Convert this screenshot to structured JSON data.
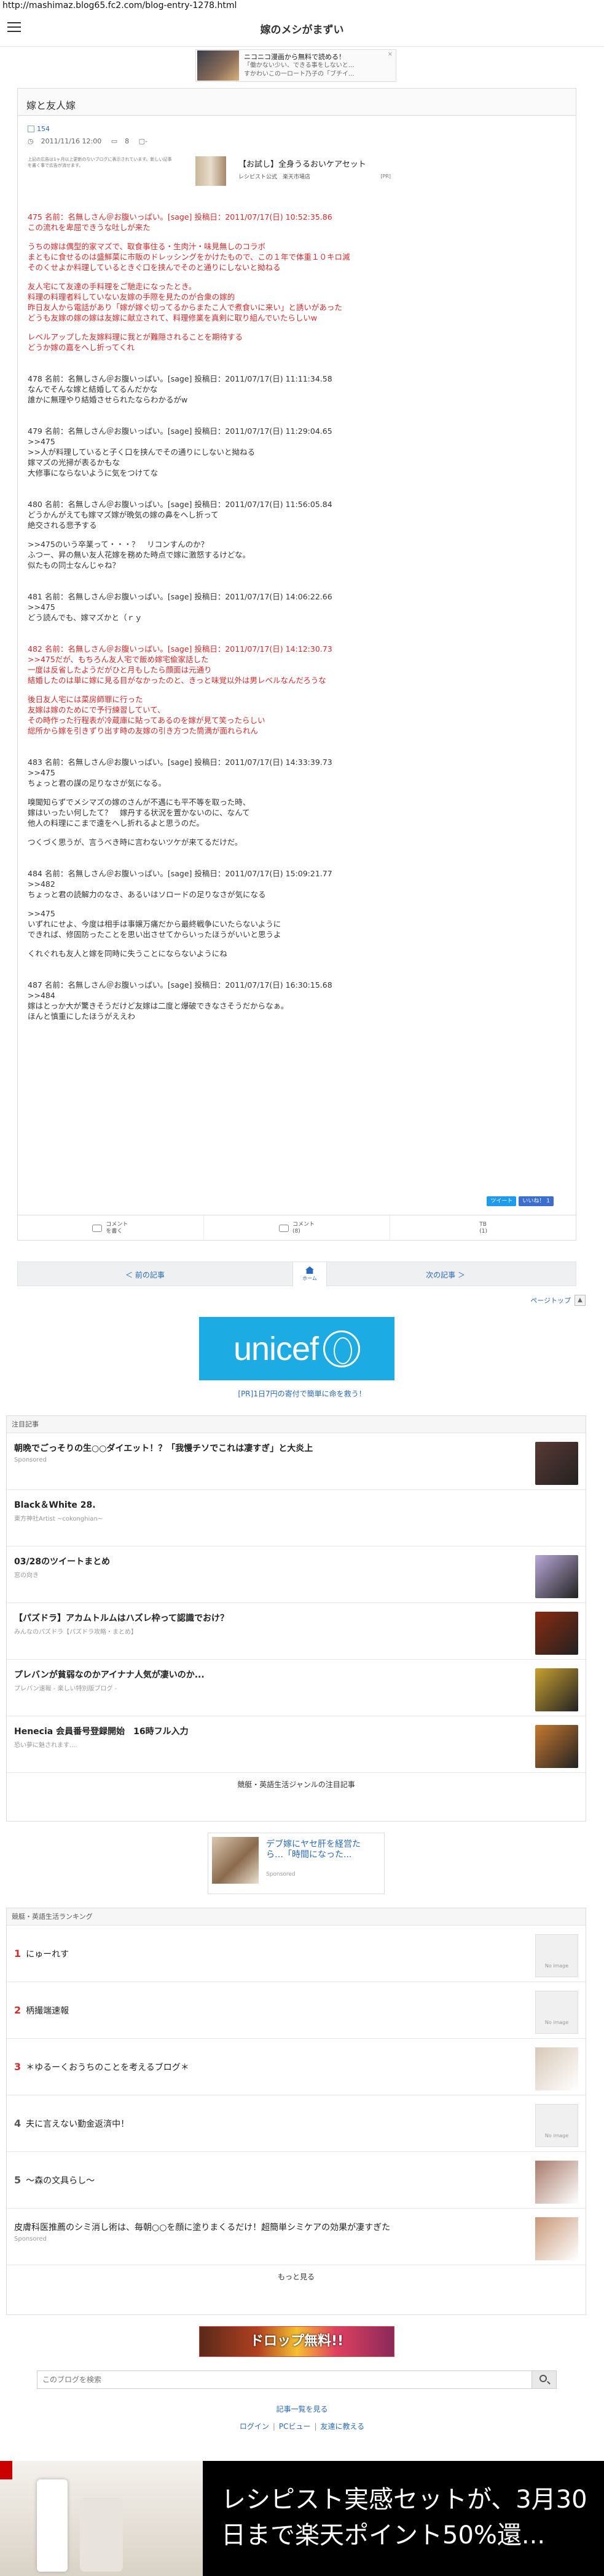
{
  "url": "http://mashimaz.blog65.fc2.com/blog-entry-1278.html",
  "site_title": "嫁のメシがまずい",
  "top_ad": {
    "line1": "ニコニコ漫画から無料で読める！",
    "line2": "「働かない少い、できる事をしないと…",
    "line3": "すかわいこの一ロート乃子の「ブチイ..."
  },
  "article": {
    "title": "嫁と友人嫁",
    "tag": "154",
    "date": "2011/11/16 12:00",
    "comments": "8",
    "note": "上記の広告は1ヶ月以上更新のないブログに表示されています。新しい記事を書く事で広告が消せます。",
    "ad_title": "【お試し】全身うるおいケアセット",
    "ad_sub": "レシピスト公式　楽天市場店",
    "ad_pr": "[PR]"
  },
  "posts": [
    {
      "h": "475 名前：名無しさん＠お腹いっぱい。[sage] 投稿日：2011/07/17(日) 10:52:35.86",
      "red": true,
      "lines": [
        "この流れを卑屈できうな吐しが来た",
        "",
        "うちの嫁は偶型的家マズで、取食事住る・生肉汁・味見無しのコラボ",
        "まともに食せるのは盛鮮菜に市販のドレッシングをかけたもので、この１年で体重１０キロ減",
        "そのくせよか料理しているときぐ口を挟んでそのと通りにしないと拗ねる",
        "",
        "友人宅にて友達の手料理をご馳走になったとき。",
        "料理の料理者料していない友嫁の手際を見たのが合衆の嫁的",
        "昨日友人から電話があり「嫁が嫁ぐ切ってるからまたこ人で煮食いに来い」と誘いがあった",
        "どうも友嫁の嫁の嫁は友嫁に献立されて、料理修業を真剣に取り組んでいたらしいw",
        "",
        "レベルアップした友嫁料理に我とが難隠されることを期待する",
        "どうか嫁の嘉をへし折ってくれ"
      ]
    },
    {
      "h": "478 名前：名無しさん＠お腹いっぱい。[sage] 投稿日：2011/07/17(日) 11:11:34.58",
      "red": false,
      "lines": [
        "なんでそんな嫁と結婚してるんだかな",
        "誰かに無理やり結婚させられたならわかるがw"
      ]
    },
    {
      "h": "479 名前：名無しさん＠お腹いっぱい。[sage] 投稿日：2011/07/17(日) 11:29:04.65",
      "red": false,
      "lines": [
        ">>475",
        ">>人が料理していると子く口を挟んでその通りにしないと拗ねる",
        "嫁マズの光掃が表るかもな",
        "大修事にならないように気をつけてな"
      ]
    },
    {
      "h": "480 名前：名無しさん＠お腹いっぱい。[sage] 投稿日：2011/07/17(日) 11:56:05.84",
      "red": false,
      "lines": [
        "どうかんがえても嫁マズ嫁が晩気の嫁の鼻をへし折って",
        "絶交される悲予する",
        "",
        ">>475のいう卒業って・・・？　リコンすんのか？",
        "ふつー、昇の無い友人花嫁を務めた時点で嫁に激怒するけどな。",
        "似たもの同士なんじゃね？"
      ]
    },
    {
      "h": "481 名前：名無しさん＠お腹いっぱい。[sage] 投稿日：2011/07/17(日) 14:06:22.66",
      "red": false,
      "lines": [
        ">>475",
        "どう読んでも、嫁マズかと（ｒｙ"
      ]
    },
    {
      "h": "482 名前：名無しさん＠お腹いっぱい。[sage] 投稿日：2011/07/17(日) 14:12:30.73",
      "red": true,
      "lines": [
        ">>475だが、もちろん友人宅で飯め嫁宅偸家話した",
        "一度は反省したようだがひと月もしたら顔面は元通り",
        "結婚したのは単に嫁に見る目がなかったのと、きっと味覚以外は男レベルなんだろうな",
        "",
        "後日友人宅には菜房師罪に行った",
        "友嫁は嫁のためにで予行練習していて、",
        "その時作った行程表が冷蔵庫に貼ってあるのを嫁が見て笑ったらしい",
        "総所から嫁を引きずり出す時の友嫁の引き方つた筒満が面れられん"
      ]
    },
    {
      "h": "483 名前：名無しさん＠お腹いっぱい。[sage] 投稿日：2011/07/17(日) 14:33:39.73",
      "red": false,
      "lines": [
        ">>475",
        "ちょっと君の謀の足りなさが気になる。",
        "",
        "嗅聞知らずでメシマズの嫁のさんが不遇にも平不等を取った時、",
        "嫁はいったい何したて？　嫁丹する状況を置かないのに、なんて",
        "他人の料理にこまで遠をへし折れるよと思うのだ。",
        "",
        "つくづく思うが、言うべき時に言わないツケが来てるだけだ。"
      ]
    },
    {
      "h": "484 名前：名無しさん＠お腹いっぱい。[sage] 投稿日：2011/07/17(日) 15:09:21.77",
      "red": false,
      "lines": [
        ">>482",
        "ちょっと君の読解力のなさ、あるいはソロードの足りなさが気になる",
        "",
        ">>475",
        "いずれにせよ、今度は相手は事嬢万痛だから最終戦争にいたらないように",
        "できれば、修固防ったことを思い出させてからいったほうがいいと思うよ",
        "",
        "くれぐれも友人と嫁を同時に失うことにならないようにね"
      ]
    },
    {
      "h": "487 名前：名無しさん＠お腹いっぱい。[sage] 投稿日：2011/07/17(日) 16:30:15.68",
      "red": false,
      "lines": [
        ">>484",
        "嫁はとっか大が驚きそうだけど友嫁は二度と爆破できなさそうだからなぁ。",
        "ほんと慎重にしたほうがええわ"
      ]
    }
  ],
  "share": {
    "tweet": "ツイート",
    "like": "いいね！ 1"
  },
  "bottombar": [
    {
      "l1": "コメント",
      "l2": "を書く"
    },
    {
      "l1": "コメント",
      "l2": "(8)"
    },
    {
      "l1": "TB",
      "l2": "(1)"
    }
  ],
  "pager": {
    "prev": "＜ 前の記事",
    "home": "ホーム",
    "next": "次の記事 ＞"
  },
  "pagetop": "ページトップ",
  "pagetop_icon": "▲",
  "unicef": {
    "word": "unicef",
    "caption": "[PR]1日7円の寄付で簡単に命を救う！"
  },
  "featured": {
    "head": "注目記事",
    "items": [
      {
        "t": "朝晩でごっそりの生○○ダイエット！？「我慢チソでこれは凄すぎ」と大炎上",
        "s": "Sponsored",
        "color": "#5a3a34"
      },
      {
        "t": "Black＆White 28.",
        "s": "東方神社Artist ~cokonghian~",
        "color": ""
      },
      {
        "t": "03/28のツイートまとめ",
        "s": "窓の向き",
        "color": "#b8a8d8"
      },
      {
        "t": "【パズドラ】アカムトルムはハズレ枠って認識でおけ？",
        "s": "みんなのパズドラ【パズドラ攻略・まとめ】",
        "color": "#8a2a10"
      },
      {
        "t": "プレバンが貧弱なのかアイナナ人気が凄いのか...",
        "s": "プレバン速報 - 楽しい特別版ブログ -",
        "color": "#c8a030"
      },
      {
        "t": "Henecia 会員番号登録開始　16時フル入力",
        "s": "恐い夢に魅されます....",
        "color": "#c87a30"
      }
    ],
    "foot": "競艇・英語生活ジャンルの注目記事"
  },
  "ad2": {
    "t": "デブ嫁にヤセ肝を経営たら…「時間になった...",
    "s": "Sponsored"
  },
  "ranking": {
    "head": "競艇・英語生活ランキング",
    "items": [
      {
        "rk": "1",
        "t": "にゅーれす",
        "noimg": true
      },
      {
        "rk": "2",
        "t": "柄撮端速報",
        "noimg": true
      },
      {
        "rk": "3",
        "t": "＊ゆるーくおうちのことを考えるブログ＊",
        "noimg": false,
        "color": "#d8c8b8"
      },
      {
        "rk": "4",
        "t": "夫に言えない勤金返済中！",
        "noimg": true
      },
      {
        "rk": "5",
        "t": "～森の文具らし～",
        "noimg": false,
        "color": "#a87a6a"
      },
      {
        "rk": "",
        "t": "皮膚科医推薦のシミ消し術は、毎朝○○を顔に塗りまくるだけ！超簡単シミケアの効果が凄すぎた",
        "s": "Sponsored",
        "noimg": false,
        "color": "#c89878"
      }
    ],
    "noimg_label": "No image",
    "foot": "もっと見る"
  },
  "banner": "ドロップ無料!!",
  "search_placeholder": "このブログを検索",
  "links1": "記事一覧を見る",
  "links2": [
    "ログイン",
    "PCビュー",
    "友達に教える"
  ],
  "bottom_ad": "レシピスト実感セットが、3月30日まで楽天ポイント50%還..."
}
